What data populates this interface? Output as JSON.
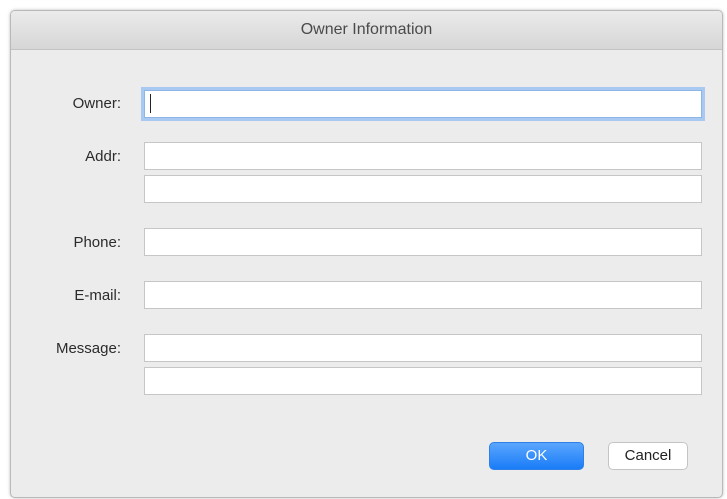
{
  "dialog": {
    "title": "Owner Information"
  },
  "form": {
    "owner_label": "Owner:",
    "owner_value": "",
    "addr_label": "Addr:",
    "addr_line1_value": "",
    "addr_line2_value": "",
    "phone_label": "Phone:",
    "phone_value": "",
    "email_label": "E-mail:",
    "email_value": "",
    "message_label": "Message:",
    "message_line1_value": "",
    "message_line2_value": ""
  },
  "buttons": {
    "ok_label": "OK",
    "cancel_label": "Cancel"
  },
  "colors": {
    "accent": "#1a7cf8",
    "focus_ring": "#a8c9f1",
    "window_bg": "#ececec"
  }
}
